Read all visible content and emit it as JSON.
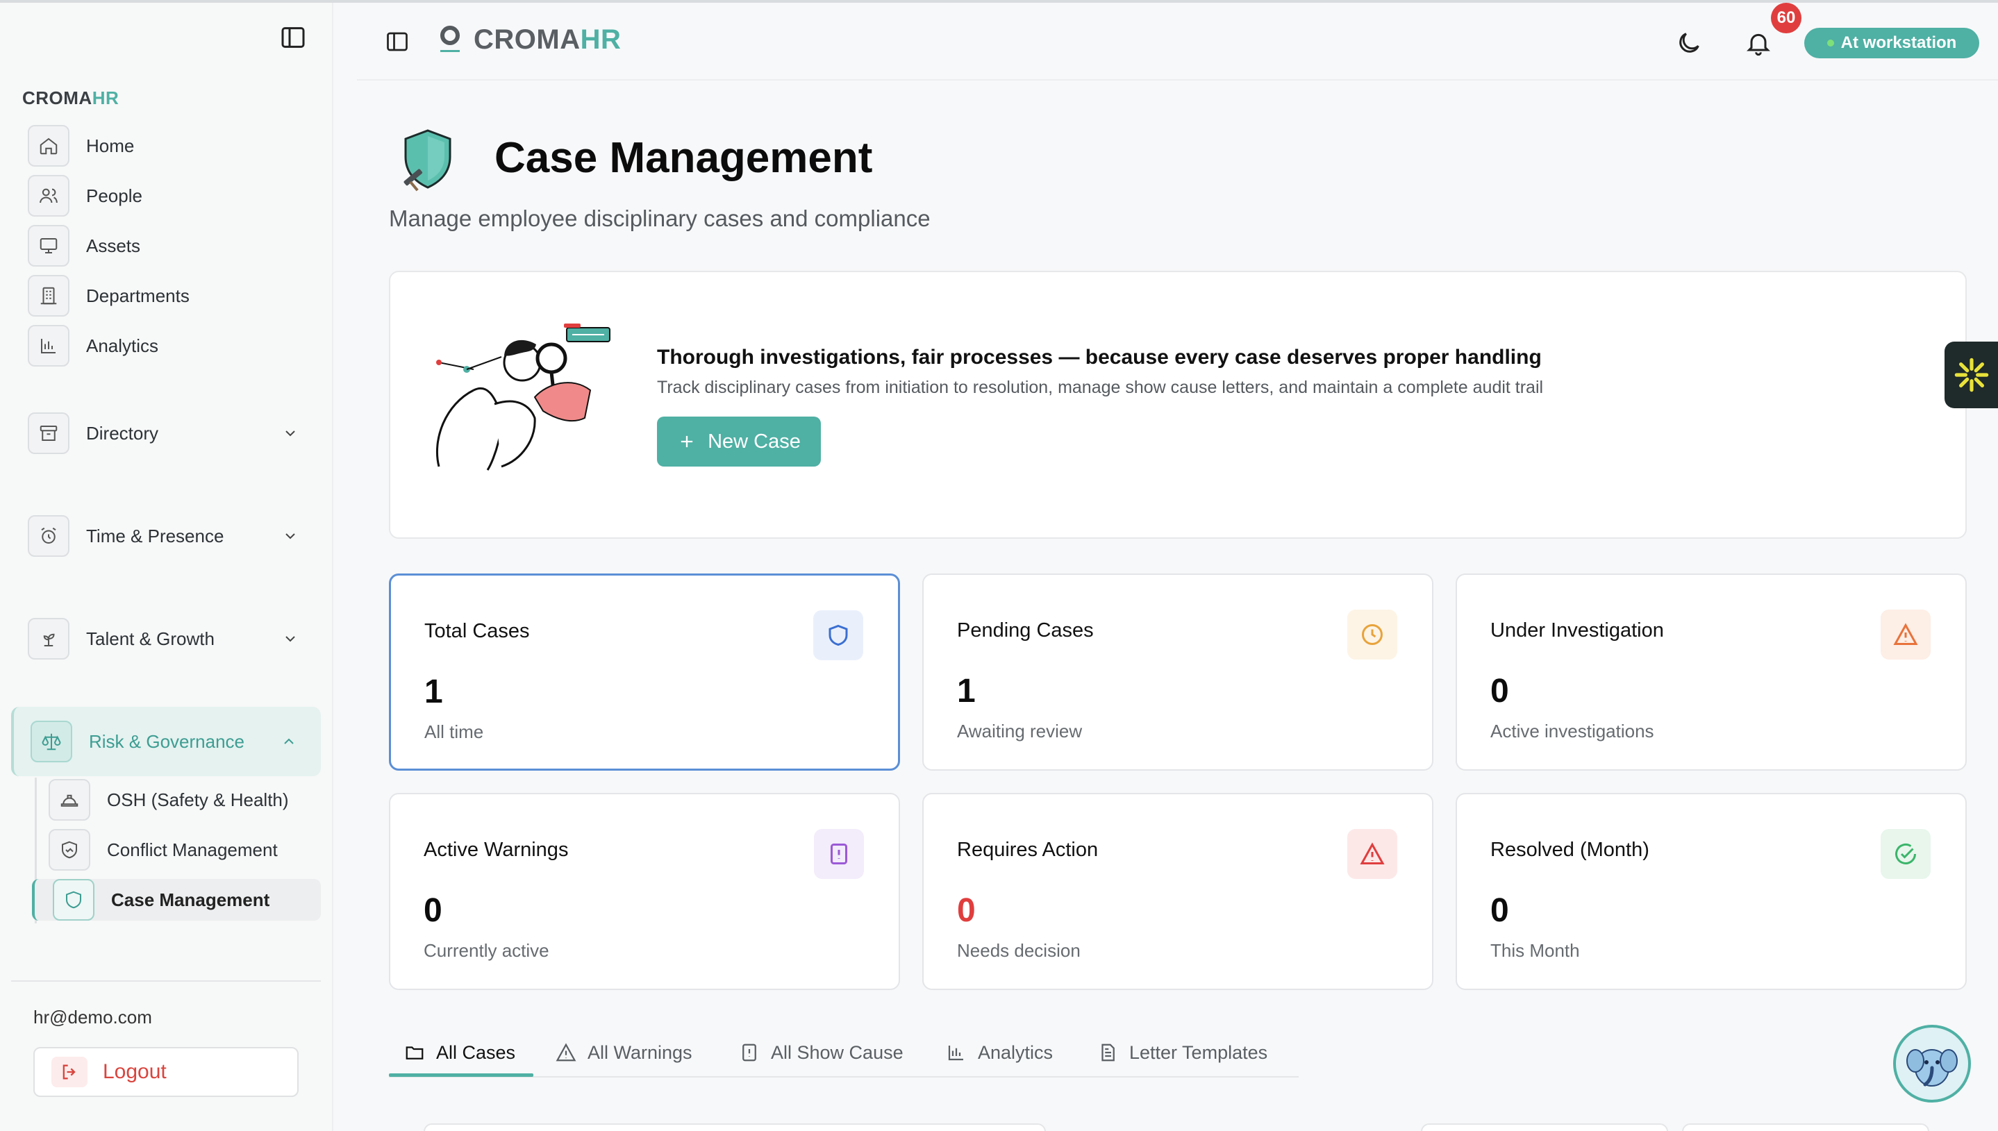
{
  "sidebar": {
    "brand": "CROMA",
    "brand_accent": "HR",
    "items": [
      {
        "label": "Home"
      },
      {
        "label": "People"
      },
      {
        "label": "Assets"
      },
      {
        "label": "Departments"
      },
      {
        "label": "Analytics"
      },
      {
        "label": "Directory"
      },
      {
        "label": "Time & Presence"
      },
      {
        "label": "Talent & Growth"
      },
      {
        "label": "Risk & Governance"
      }
    ],
    "sub_items": [
      {
        "label": "OSH (Safety & Health)"
      },
      {
        "label": "Conflict Management"
      },
      {
        "label": "Case Management"
      }
    ],
    "email": "hr@demo.com",
    "logout_label": "Logout"
  },
  "header": {
    "logo_word": "CROMA",
    "logo_accent": "HR",
    "notification_count": "60",
    "status_label": "At workstation"
  },
  "page": {
    "title": "Case Management",
    "subtitle": "Manage employee disciplinary cases and compliance"
  },
  "hero": {
    "title": "Thorough investigations, fair processes — because every case deserves proper handling",
    "description": "Track disciplinary cases from initiation to resolution, manage show cause letters, and maintain a complete audit trail",
    "button_label": "New Case"
  },
  "stats": [
    {
      "label": "Total Cases",
      "value": "1",
      "sub": "All time",
      "icon": "shield-icon",
      "color": "#3b6fd1"
    },
    {
      "label": "Pending Cases",
      "value": "1",
      "sub": "Awaiting review",
      "icon": "clock-icon",
      "color": "#e8a33b"
    },
    {
      "label": "Under Investigation",
      "value": "0",
      "sub": "Active investigations",
      "icon": "warning-icon",
      "color": "#e8733b"
    },
    {
      "label": "Active Warnings",
      "value": "0",
      "sub": "Currently active",
      "icon": "alert-square-icon",
      "color": "#9b59d6"
    },
    {
      "label": "Requires Action",
      "value": "0",
      "sub": "Needs decision",
      "icon": "alert-triangle-icon",
      "color": "#e03e3e"
    },
    {
      "label": "Resolved (Month)",
      "value": "0",
      "sub": "This Month",
      "icon": "check-circle-icon",
      "color": "#3bb56a"
    }
  ],
  "tabs": [
    {
      "label": "All Cases",
      "active": true
    },
    {
      "label": "All Warnings"
    },
    {
      "label": "All Show Cause"
    },
    {
      "label": "Analytics"
    },
    {
      "label": "Letter Templates"
    }
  ],
  "colors": {
    "accent": "#4fb0a4",
    "danger": "#e03e3e"
  }
}
